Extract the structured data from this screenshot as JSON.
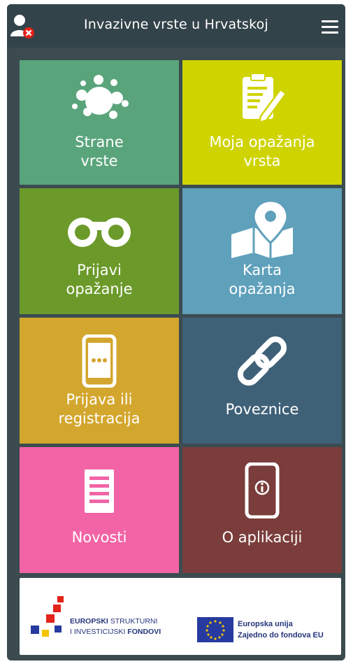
{
  "header": {
    "title": "Invazivne vrste u Hrvatskoj",
    "user_icon": "user-remove-icon",
    "menu_icon": "hamburger-menu-icon"
  },
  "tiles": [
    {
      "label": "Strane\nvrste",
      "icon": "bubbles-icon",
      "color": "#5aa47c"
    },
    {
      "label": "Moja opažanja\nvrsta",
      "icon": "clipboard-pencil-icon",
      "color": "#cfd400"
    },
    {
      "label": "Prijavi\nopažanje",
      "icon": "binoculars-icon",
      "color": "#6c9a2a"
    },
    {
      "label": "Karta\nopažanja",
      "icon": "map-pin-icon",
      "color": "#5fa0bb"
    },
    {
      "label": "Prijava ili\nregistracija",
      "icon": "mobile-phone-icon",
      "color": "#d3a62d"
    },
    {
      "label": "Poveznice",
      "icon": "link-icon",
      "color": "#3f6178"
    },
    {
      "label": "Novosti",
      "icon": "document-lines-icon",
      "color": "#f264a6"
    },
    {
      "label": "O aplikaciji",
      "icon": "phone-info-icon",
      "color": "#7a3d3b"
    }
  ],
  "footer": {
    "fund_line1_bold": "EUROPSKI",
    "fund_line1_rest": "STRUKTURNI",
    "fund_line2_rest": "I INVESTICIJSKI",
    "fund_line2_bold": "FONDOVI",
    "eu_line1": "Europska unija",
    "eu_line2": "Zajedno do fondova EU"
  }
}
